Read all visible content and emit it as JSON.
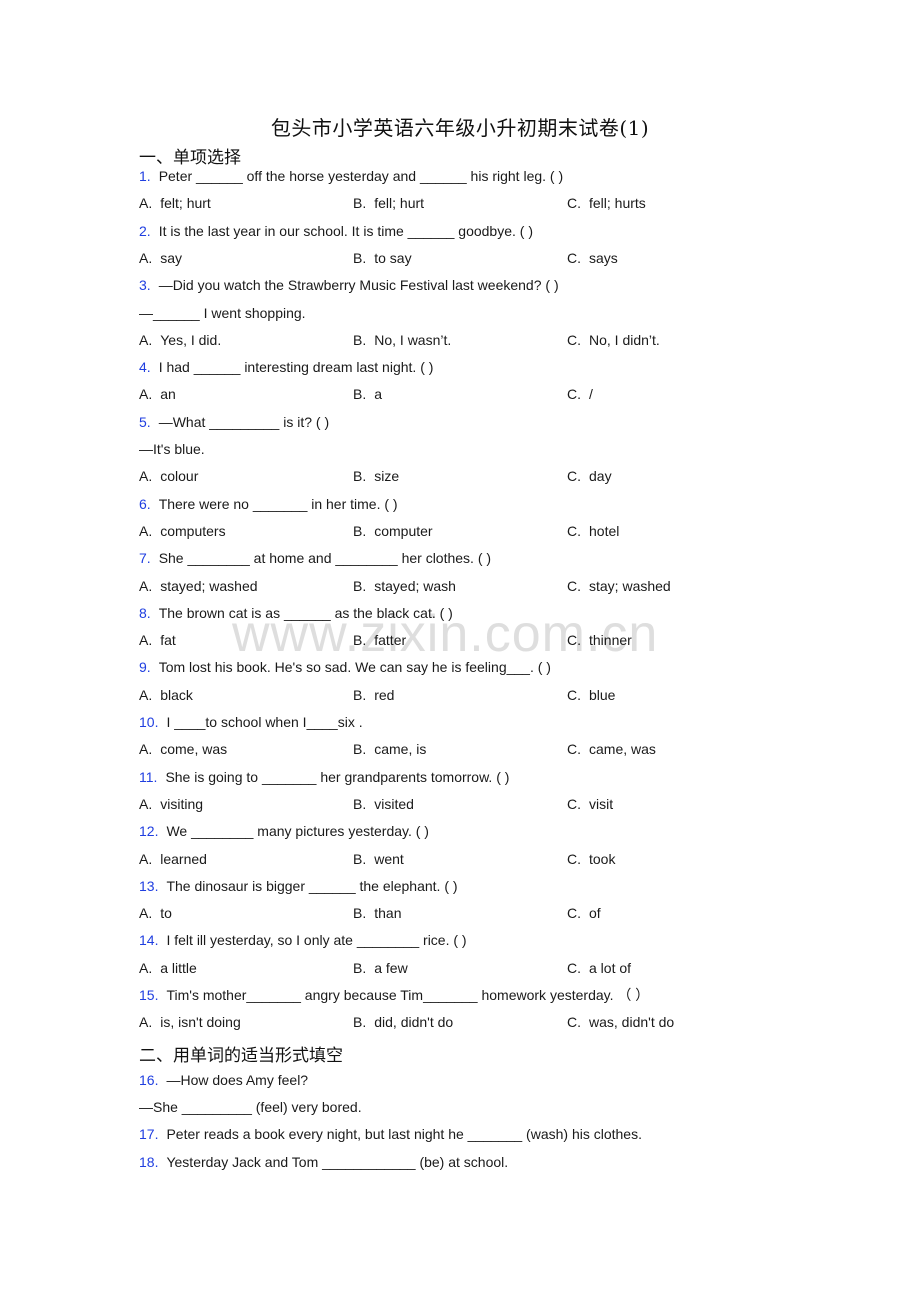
{
  "document": {
    "title": "包头市小学英语六年级小升初期末试卷(1)",
    "watermark": "www.zixin.com.cn",
    "accent_color": "#1f3ee0"
  },
  "sections": [
    {
      "heading": "一、单项选择",
      "questions": [
        {
          "num": "1.",
          "lines": [
            "Peter ______ off the horse yesterday and ______ his right leg. (    )"
          ],
          "options": {
            "A": "felt; hurt",
            "B": "fell; hurt",
            "C": "fell; hurts"
          }
        },
        {
          "num": "2.",
          "lines": [
            "It is the last year in our school. It is time ______ goodbye. (   )"
          ],
          "options": {
            "A": "say",
            "B": "to say",
            "C": "says"
          }
        },
        {
          "num": "3.",
          "lines": [
            "—Did you watch the Strawberry Music Festival last weekend? (    )",
            "—______ I went shopping."
          ],
          "options": {
            "A": "Yes, I did.",
            "B": "No, I wasn’t.",
            "C": "No, I didn’t."
          }
        },
        {
          "num": "4.",
          "lines": [
            "I had ______ interesting dream last night. (    )"
          ],
          "options": {
            "A": "an",
            "B": "a",
            "C": "/"
          }
        },
        {
          "num": "5.",
          "lines": [
            "—What _________ is it? (    )",
            "—It's blue."
          ],
          "options": {
            "A": "colour",
            "B": "size",
            "C": "day"
          }
        },
        {
          "num": "6.",
          "lines": [
            "There were no _______ in her time. (   )"
          ],
          "options": {
            "A": "computers",
            "B": "computer",
            "C": "hotel"
          }
        },
        {
          "num": "7.",
          "lines": [
            "She ________ at home and ________ her clothes. (   )"
          ],
          "options": {
            "A": "stayed; washed",
            "B": "stayed; wash",
            "C": "stay; washed"
          }
        },
        {
          "num": "8.",
          "lines": [
            "The brown cat is as ______ as the black cat. (   )"
          ],
          "options": {
            "A": "fat",
            "B": "fatter",
            "C": "thinner"
          }
        },
        {
          "num": "9.",
          "lines": [
            "Tom lost his book. He's so sad. We can say he is feeling___.     (    )"
          ],
          "options": {
            "A": "black",
            "B": "red",
            "C": "blue"
          }
        },
        {
          "num": "10.",
          "lines": [
            "I ____to school when I____six ."
          ],
          "options": {
            "A": "come, was",
            "B": "came, is",
            "C": "came, was"
          }
        },
        {
          "num": "11.",
          "lines": [
            "She is going to _______ her grandparents tomorrow. (   )"
          ],
          "options": {
            "A": "visiting",
            "B": "visited",
            "C": "visit"
          }
        },
        {
          "num": "12.",
          "lines": [
            "We ________ many pictures yesterday. (     )"
          ],
          "options": {
            "A": "learned",
            "B": "went",
            "C": "took"
          }
        },
        {
          "num": "13.",
          "lines": [
            "The dinosaur is bigger ______ the elephant. (   )"
          ],
          "options": {
            "A": "to",
            "B": "than",
            "C": "of"
          }
        },
        {
          "num": "14.",
          "lines": [
            "I felt ill yesterday, so I only ate ________ rice. (    )"
          ],
          "options": {
            "A": "a little",
            "B": "a few",
            "C": "a lot of"
          }
        },
        {
          "num": "15.",
          "lines": [
            "Tim's mother_______ angry because Tim_______ homework yesterday. （    ）"
          ],
          "options": {
            "A": "is, isn't doing",
            "B": "did, didn't do",
            "C": "was, didn't do"
          }
        }
      ]
    },
    {
      "heading": "二、用单词的适当形式填空",
      "questions": [
        {
          "num": "16.",
          "lines": [
            "—How does Amy feel?",
            "—She _________ (feel) very bored."
          ]
        },
        {
          "num": "17.",
          "lines": [
            "Peter reads a book every night, but last night he _______ (wash) his clothes."
          ]
        },
        {
          "num": "18.",
          "lines": [
            "Yesterday Jack and Tom ____________ (be) at school."
          ]
        }
      ]
    }
  ]
}
